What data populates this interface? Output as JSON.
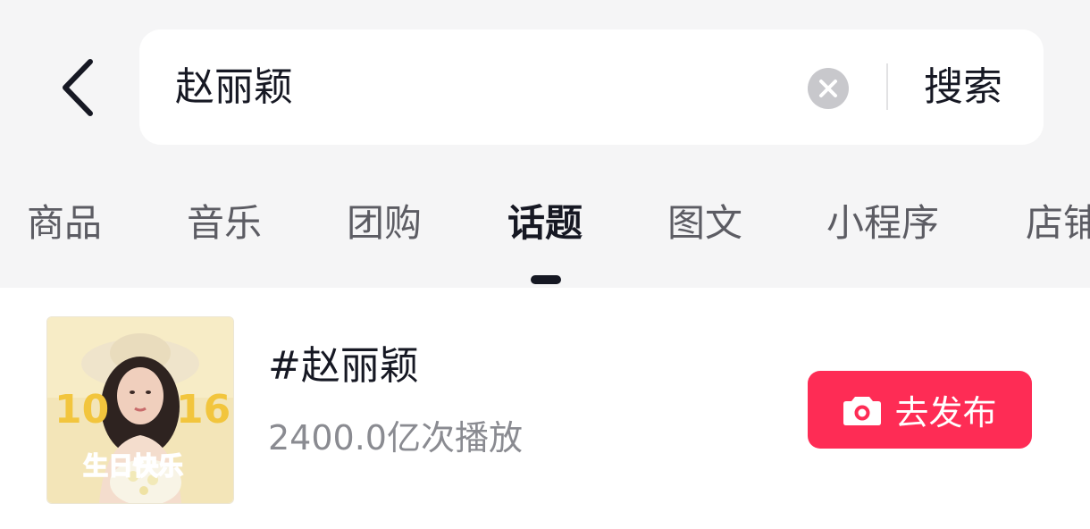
{
  "search": {
    "query": "赵丽颖",
    "submit_label": "搜索"
  },
  "tabs": [
    {
      "label": "商品"
    },
    {
      "label": "音乐"
    },
    {
      "label": "团购"
    },
    {
      "label": "话题",
      "active": true
    },
    {
      "label": "图文"
    },
    {
      "label": "小程序"
    },
    {
      "label": "店铺"
    }
  ],
  "result": {
    "title": "#赵丽颖",
    "plays": "2400.0亿次播放",
    "publish_label": "去发布",
    "thumbnail": {
      "big_numbers_left": "10",
      "big_numbers_right": "16",
      "caption": "生日快乐"
    }
  },
  "colors": {
    "accent": "#fe2c55",
    "background_top": "#f5f5f6",
    "text_primary": "#161823",
    "text_secondary": "#8a8b91"
  },
  "icons": {
    "back": "chevron-left-icon",
    "clear": "clear-icon",
    "camera": "camera-icon"
  }
}
